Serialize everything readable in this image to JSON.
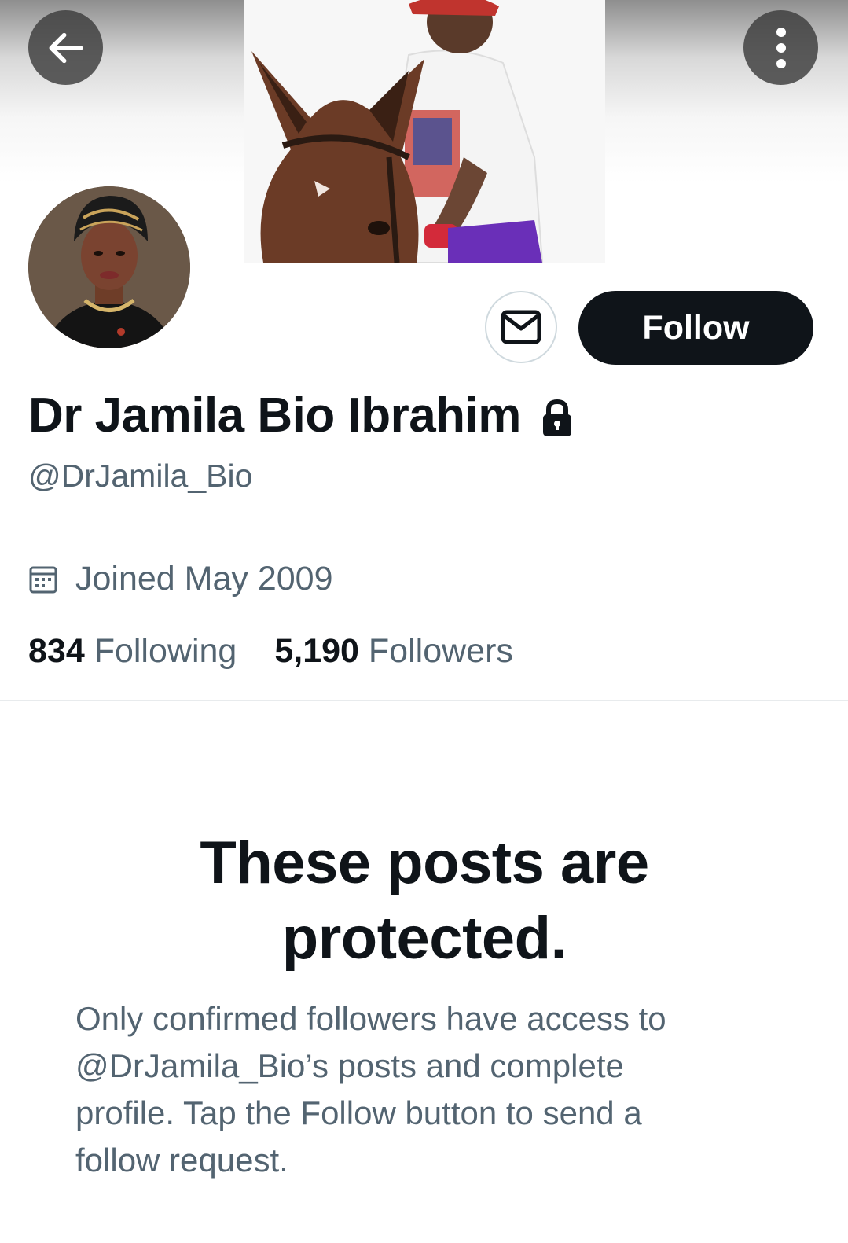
{
  "banner": {
    "description_icon": "profile-banner-photo"
  },
  "header": {
    "back_icon": "arrow-left-icon",
    "more_icon": "more-vertical-icon"
  },
  "profile": {
    "name": "Dr Jamila Bio Ibrahim",
    "handle": "@DrJamila_Bio",
    "joined": "Joined May 2009",
    "following_count": "834",
    "following_label": "Following",
    "followers_count": "5,190",
    "followers_label": "Followers"
  },
  "actions": {
    "follow_label": "Follow",
    "message_icon": "envelope-icon"
  },
  "protected": {
    "title": "These posts are protected.",
    "description": "Only confirmed followers have access to @DrJamila_Bio’s posts and complete profile. Tap the Follow button to send a follow request."
  },
  "colors": {
    "primary": "#0f1419",
    "secondary": "#536471",
    "border": "#cfd9de"
  }
}
